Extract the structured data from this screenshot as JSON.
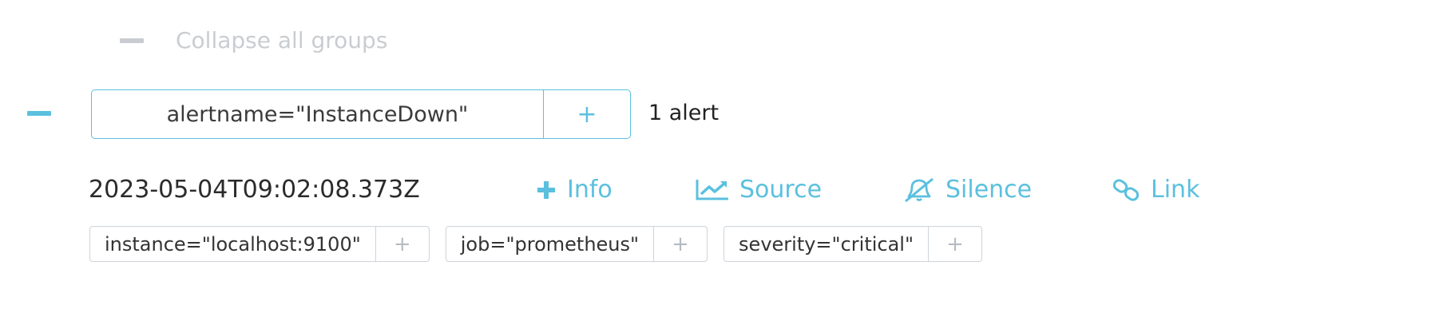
{
  "collapse_all": {
    "label": "Collapse all groups",
    "icon": "minus-icon"
  },
  "group": {
    "toggle_icon": "minus-icon",
    "label": "alertname=\"InstanceDown\"",
    "add_label": "+",
    "count": "1 alert"
  },
  "alert": {
    "timestamp": "2023-05-04T09:02:08.373Z",
    "actions": {
      "info": "Info",
      "source": "Source",
      "silence": "Silence",
      "link": "Link"
    },
    "labels": [
      {
        "text": "instance=\"localhost:9100\"",
        "add": "+"
      },
      {
        "text": "job=\"prometheus\"",
        "add": "+"
      },
      {
        "text": "severity=\"critical\"",
        "add": "+"
      }
    ]
  },
  "colors": {
    "accent": "#5bc0de",
    "muted": "#c9cdd1",
    "label_border": "#ced4da"
  }
}
